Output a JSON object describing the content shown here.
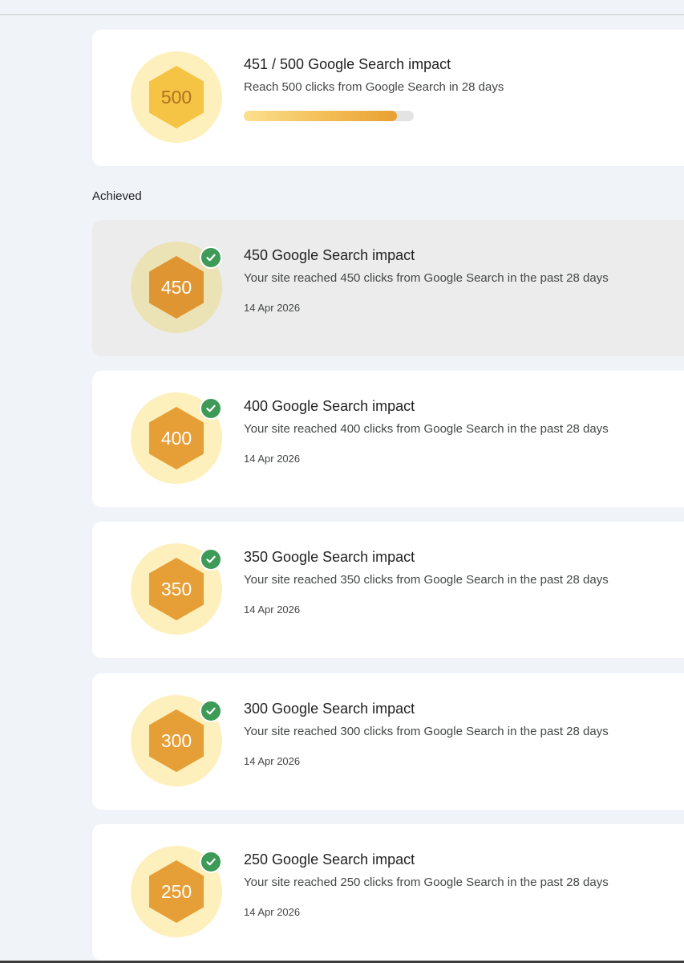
{
  "goal": {
    "badge_value": "500",
    "title": "451 / 500 Google Search impact",
    "description": "Reach 500 clicks from Google Search in 28 days",
    "progress_current": 451,
    "progress_target": 500
  },
  "achieved_section_label": "Achieved",
  "achievements": [
    {
      "badge_value": "450",
      "title": "450 Google Search impact",
      "description": "Your site reached 450 clicks from Google Search in the past 28 days",
      "date": "14 Apr 2026"
    },
    {
      "badge_value": "400",
      "title": "400 Google Search impact",
      "description": "Your site reached 400 clicks from Google Search in the past 28 days",
      "date": "14 Apr 2026"
    },
    {
      "badge_value": "350",
      "title": "350 Google Search impact",
      "description": "Your site reached 350 clicks from Google Search in the past 28 days",
      "date": "14 Apr 2026"
    },
    {
      "badge_value": "300",
      "title": "300 Google Search impact",
      "description": "Your site reached 300 clicks from Google Search in the past 28 days",
      "date": "14 Apr 2026"
    },
    {
      "badge_value": "250",
      "title": "250 Google Search impact",
      "description": "Your site reached 250 clicks from Google Search in the past 28 days",
      "date": "14 Apr 2026"
    }
  ],
  "colors": {
    "page_background": "#f0f4f9",
    "badge_ring": "#fdf0bd",
    "badge_hex_achieved": "#e69e36",
    "badge_hex_goal": "#f6c445",
    "check_green": "#3e9b57"
  },
  "icons": {
    "check": "check-circle-icon",
    "badge": "hexagon-badge-icon"
  }
}
